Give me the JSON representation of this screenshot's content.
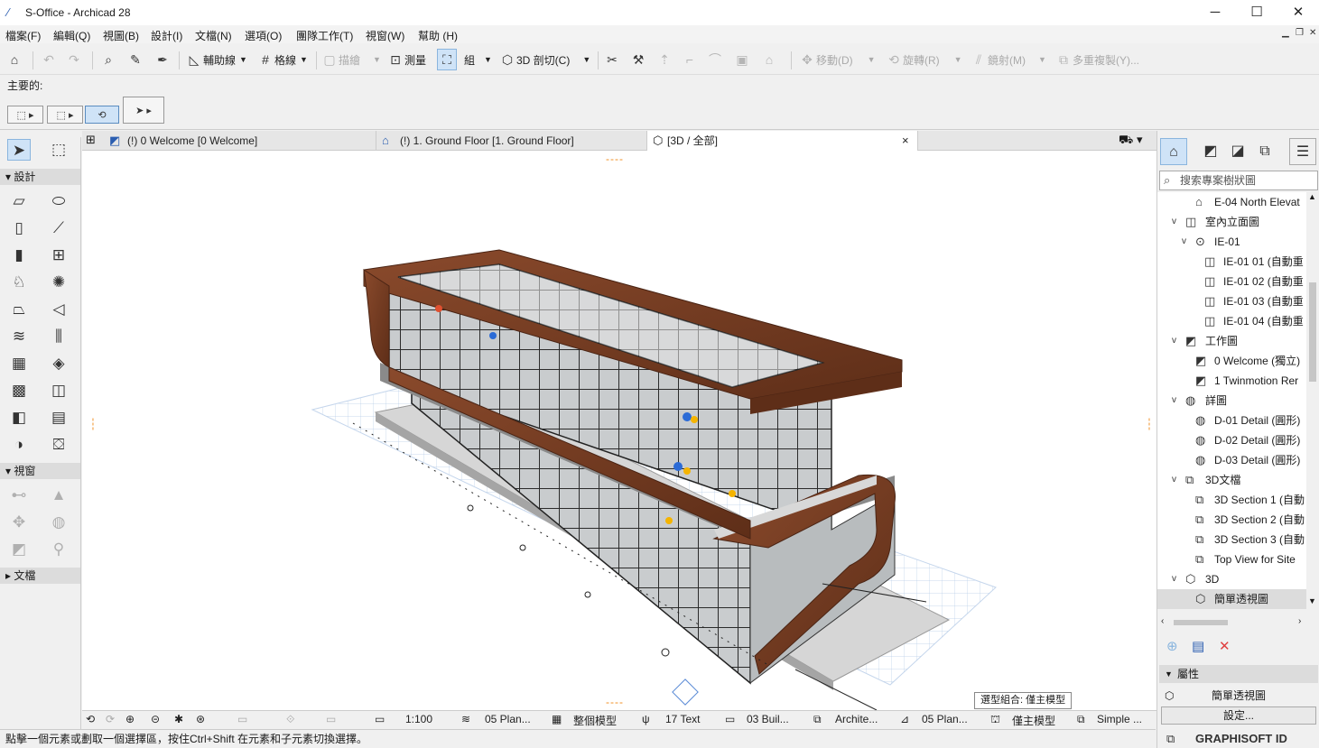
{
  "app": {
    "title": "S-Office - Archicad 28"
  },
  "menubar": [
    "檔案(F)",
    "編輯(Q)",
    "視圖(B)",
    "設計(I)",
    "文檔(N)",
    "選項(O)",
    "團隊工作(T)",
    "視窗(W)",
    "幫助 (H)"
  ],
  "toolbar": {
    "guide": "輔助線",
    "grid": "格線",
    "trace": "描繪",
    "measure": "測量",
    "group": "組",
    "cutaway": "3D 剖切(C)",
    "move": "移動(D)",
    "rotate": "旋轉(R)",
    "mirror": "鏡射(M)",
    "multiply": "多重複製(Y)..."
  },
  "infobox": {
    "label": "主要的:"
  },
  "toolbox": {
    "design": "設計",
    "view": "視窗",
    "document": "文檔"
  },
  "tabs": [
    {
      "label": "(!) 0 Welcome [0 Welcome]"
    },
    {
      "label": "(!) 1. Ground Floor [1. Ground Floor]"
    },
    {
      "label": "[3D / 全部]"
    }
  ],
  "tab_close": "×",
  "navigator": {
    "search_placeholder": "搜索專案樹狀圖",
    "items": [
      {
        "label": "E-04 North Elevat"
      },
      {
        "label": "室內立面圖"
      },
      {
        "label": "IE-01"
      },
      {
        "label": "IE-01 01 (自動重"
      },
      {
        "label": "IE-01 02 (自動重"
      },
      {
        "label": "IE-01 03 (自動重"
      },
      {
        "label": "IE-01 04 (自動重"
      },
      {
        "label": "工作圖"
      },
      {
        "label": "0 Welcome (獨立)"
      },
      {
        "label": "1 Twinmotion Rer"
      },
      {
        "label": "詳圖"
      },
      {
        "label": "D-01 Detail (圓形)"
      },
      {
        "label": "D-02 Detail (圓形)"
      },
      {
        "label": "D-03 Detail (圓形)"
      },
      {
        "label": "3D文檔"
      },
      {
        "label": "3D Section 1 (自動"
      },
      {
        "label": "3D Section 2 (自動"
      },
      {
        "label": "3D Section 3 (自動"
      },
      {
        "label": "Top View for Site"
      },
      {
        "label": "3D"
      },
      {
        "label": "簡單透視圖"
      }
    ],
    "properties_header": "屬性",
    "properties_name": "簡單透視圖",
    "settings_button": "設定...",
    "graphisoft_id": "GRAPHISOFT ID"
  },
  "statusbar": {
    "scale": "1:100",
    "layer": "05 Plan...",
    "model": "整個模型",
    "pen": "17 Text",
    "mvo": "03 Buil...",
    "renovation": "Archite...",
    "plan": "05 Plan...",
    "structure": "僅主模型",
    "partial": "Simple ..."
  },
  "tooltip": "選型組合:  僅主模型",
  "hint": "點擊一個元素或劃取一個選擇區，按住Ctrl+Shift 在元素和子元素切換選擇。",
  "colors": {
    "accent": "#2a5db0",
    "selected": "#cfe3f7",
    "roof": "#7a3b22"
  }
}
